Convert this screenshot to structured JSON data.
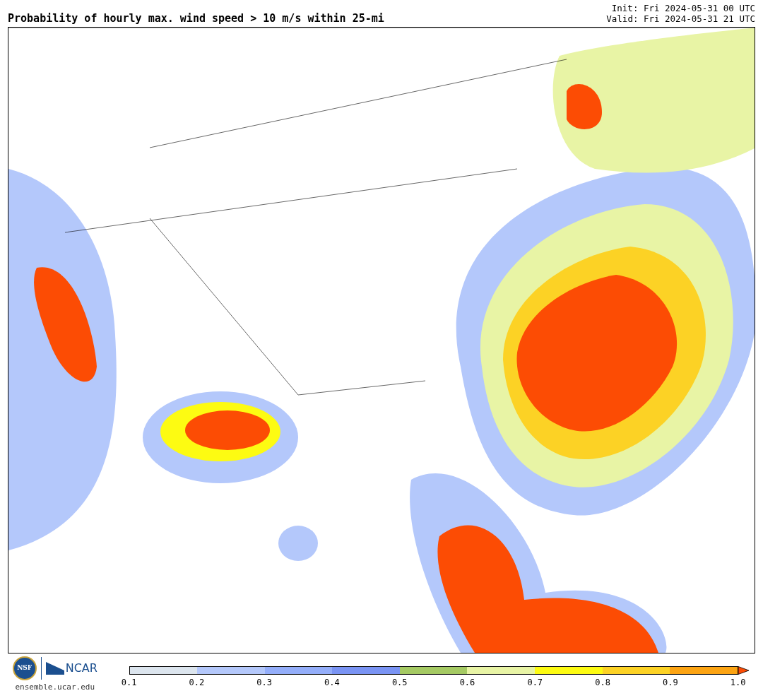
{
  "title": "Probability of hourly max. wind speed > 10 m/s within 25-mi",
  "init": "Init: Fri 2024-05-31 00 UTC",
  "valid": "Valid: Fri 2024-05-31 21 UTC",
  "logos": {
    "nsf": "NSF",
    "ncar": "NCAR",
    "site": "ensemble.ucar.edu"
  },
  "colorbar": {
    "bins": [
      {
        "kind": "bin",
        "color": "#dce5ee"
      },
      {
        "kind": "bin",
        "color": "#b4c8fb"
      },
      {
        "kind": "bin",
        "color": "#94aefa"
      },
      {
        "kind": "bin",
        "color": "#7a94f4"
      },
      {
        "kind": "bin",
        "color": "#a5ca63"
      },
      {
        "kind": "bin",
        "color": "#e8f4a5"
      },
      {
        "kind": "bin",
        "color": "#fdfb12"
      },
      {
        "kind": "bin",
        "color": "#fcd225"
      },
      {
        "kind": "bin",
        "color": "#fca413"
      },
      {
        "kind": "extension",
        "color": "#fc4c04"
      }
    ],
    "ticks": [
      "0.1",
      "0.2",
      "0.3",
      "0.4",
      "0.5",
      "0.6",
      "0.7",
      "0.8",
      "0.9",
      "1.0"
    ]
  }
}
